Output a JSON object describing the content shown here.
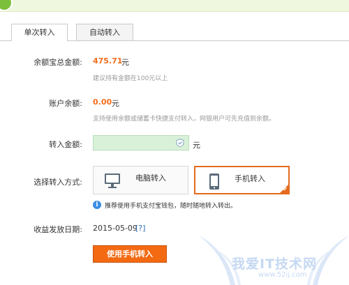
{
  "tabs": [
    {
      "label": "单次转入",
      "active": true
    },
    {
      "label": "自动转入",
      "active": false
    }
  ],
  "yuebao_total": {
    "label": "余额宝总金额:",
    "value": "475.71",
    "unit": "元",
    "hint": "建议持有金额在100元以上"
  },
  "account_balance": {
    "label": "账户余额:",
    "value": "0.00",
    "unit": "元",
    "hint": "支持使用余额或储蓄卡快捷支付转入，网银用户可先充值到余额。"
  },
  "transfer_amount": {
    "label": "转入金额:",
    "value": "",
    "placeholder": "",
    "unit": "元",
    "icon": "keyboard-shield-icon"
  },
  "method": {
    "label": "选择转入方式:",
    "options": [
      {
        "label": "电脑转入",
        "icon": "computer-icon",
        "selected": false
      },
      {
        "label": "手机转入",
        "icon": "phone-icon",
        "selected": true
      }
    ],
    "tip": "推荐使用手机支付宝钱包，随时随地转入转出。"
  },
  "income_date": {
    "label": "收益发放日期:",
    "value": "2015-05-09",
    "help": "[?]"
  },
  "submit_label": "使用手机转入",
  "watermark": {
    "text": "我爱IT技术网",
    "url": "www.52ij.com"
  },
  "colors": {
    "accent": "#f36a13",
    "amount": "#f36d1c",
    "banner": "#eff8df",
    "input_bg": "#d9f1d9",
    "link": "#2a6bb5",
    "hint": "#999999"
  }
}
